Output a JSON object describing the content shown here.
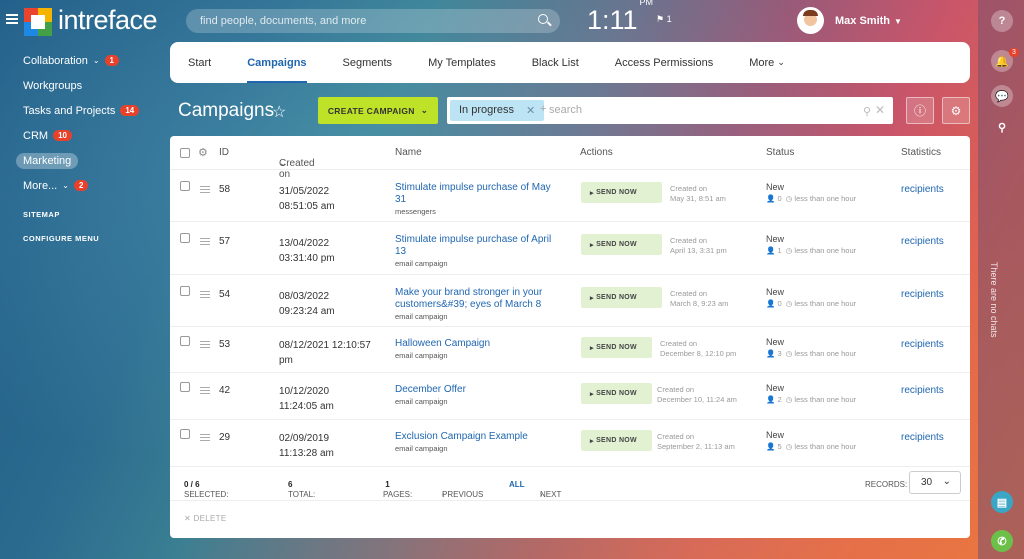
{
  "header": {
    "brand": "intreface",
    "search_placeholder": "find people, documents, and more",
    "time": "1:11",
    "ampm": "PM",
    "flag_count": "1",
    "user_name": "Max Smith"
  },
  "sidebar": {
    "items": [
      {
        "label": "Collaboration",
        "badge": "1",
        "caret": true
      },
      {
        "label": "Workgroups"
      },
      {
        "label": "Tasks and Projects",
        "badge": "14"
      },
      {
        "label": "CRM",
        "badge": "10"
      },
      {
        "label": "Marketing",
        "active": true
      },
      {
        "label": "More...",
        "badge": "2",
        "caret": true
      }
    ],
    "sitemap": "SITEMAP",
    "configure": "CONFIGURE MENU"
  },
  "tabs": [
    "Start",
    "Campaigns",
    "Segments",
    "My Templates",
    "Black List",
    "Access Permissions",
    "More"
  ],
  "page": {
    "title": "Campaigns",
    "create_label": "CREATE CAMPAIGN",
    "filter_chip": "In progress",
    "filter_plus": "+",
    "filter_placeholder": "search"
  },
  "table": {
    "headers": {
      "id": "ID",
      "created": "Created on",
      "name": "Name",
      "actions": "Actions",
      "status": "Status",
      "stats": "Statistics"
    },
    "rows": [
      {
        "id": "58",
        "date": "31/05/2022",
        "time": "08:51:05 am",
        "name": "Stimulate impulse purchase of May 31",
        "type": "messengers",
        "send": "SEND NOW",
        "created_label": "Created on",
        "created_val": "May 31, 8:51 am",
        "status": "New",
        "count": "0",
        "dur": "less than one hour",
        "stat": "recipients"
      },
      {
        "id": "57",
        "date": "13/04/2022",
        "time": "03:31:40 pm",
        "name": "Stimulate impulse purchase of April 13",
        "type": "email campaign",
        "send": "SEND NOW",
        "created_label": "Created on",
        "created_val": "April 13, 3:31 pm",
        "status": "New",
        "count": "1",
        "dur": "less than one hour",
        "stat": "recipients"
      },
      {
        "id": "54",
        "date": "08/03/2022",
        "time": "09:23:24 am",
        "name": "Make your brand stronger in your customers&#39; eyes of March 8",
        "type": "email campaign",
        "send": "SEND NOW",
        "created_label": "Created on",
        "created_val": "March 8, 9:23 am",
        "status": "New",
        "count": "0",
        "dur": "less than one hour",
        "stat": "recipients"
      },
      {
        "id": "53",
        "date": "08/12/2021 12:10:57",
        "time": "pm",
        "name": "Halloween Campaign",
        "type": "email campaign",
        "send": "SEND NOW",
        "created_label": "Created on",
        "created_val": "December 8, 12:10 pm",
        "status": "New",
        "count": "3",
        "dur": "less than one hour",
        "stat": "recipients"
      },
      {
        "id": "42",
        "date": "10/12/2020",
        "time": "11:24:05 am",
        "name": "December Offer",
        "type": "email campaign",
        "send": "SEND NOW",
        "created_label": "Created on",
        "created_val": "December 10, 11:24 am",
        "status": "New",
        "count": "2",
        "dur": "less than one hour",
        "stat": "recipients"
      },
      {
        "id": "29",
        "date": "02/09/2019",
        "time": "11:13:28 am",
        "name": "Exclusion Campaign Example",
        "type": "email campaign",
        "send": "SEND NOW",
        "created_label": "Created on",
        "created_val": "September 2, 11:13 am",
        "status": "New",
        "count": "5",
        "dur": "less than one hour",
        "stat": "recipients"
      }
    ]
  },
  "footer": {
    "selected_label": "SELECTED:",
    "selected_val": "0 / 6",
    "total_label": "TOTAL:",
    "total_val": "6",
    "pages_label": "PAGES:",
    "pages_val": "1",
    "prev": "PREVIOUS",
    "all": "ALL",
    "next": "NEXT",
    "records_label": "RECORDS:",
    "records_val": "30",
    "delete": "DELETE"
  },
  "rail": {
    "notif_badge": "3",
    "no_chats": "There are no chats"
  }
}
